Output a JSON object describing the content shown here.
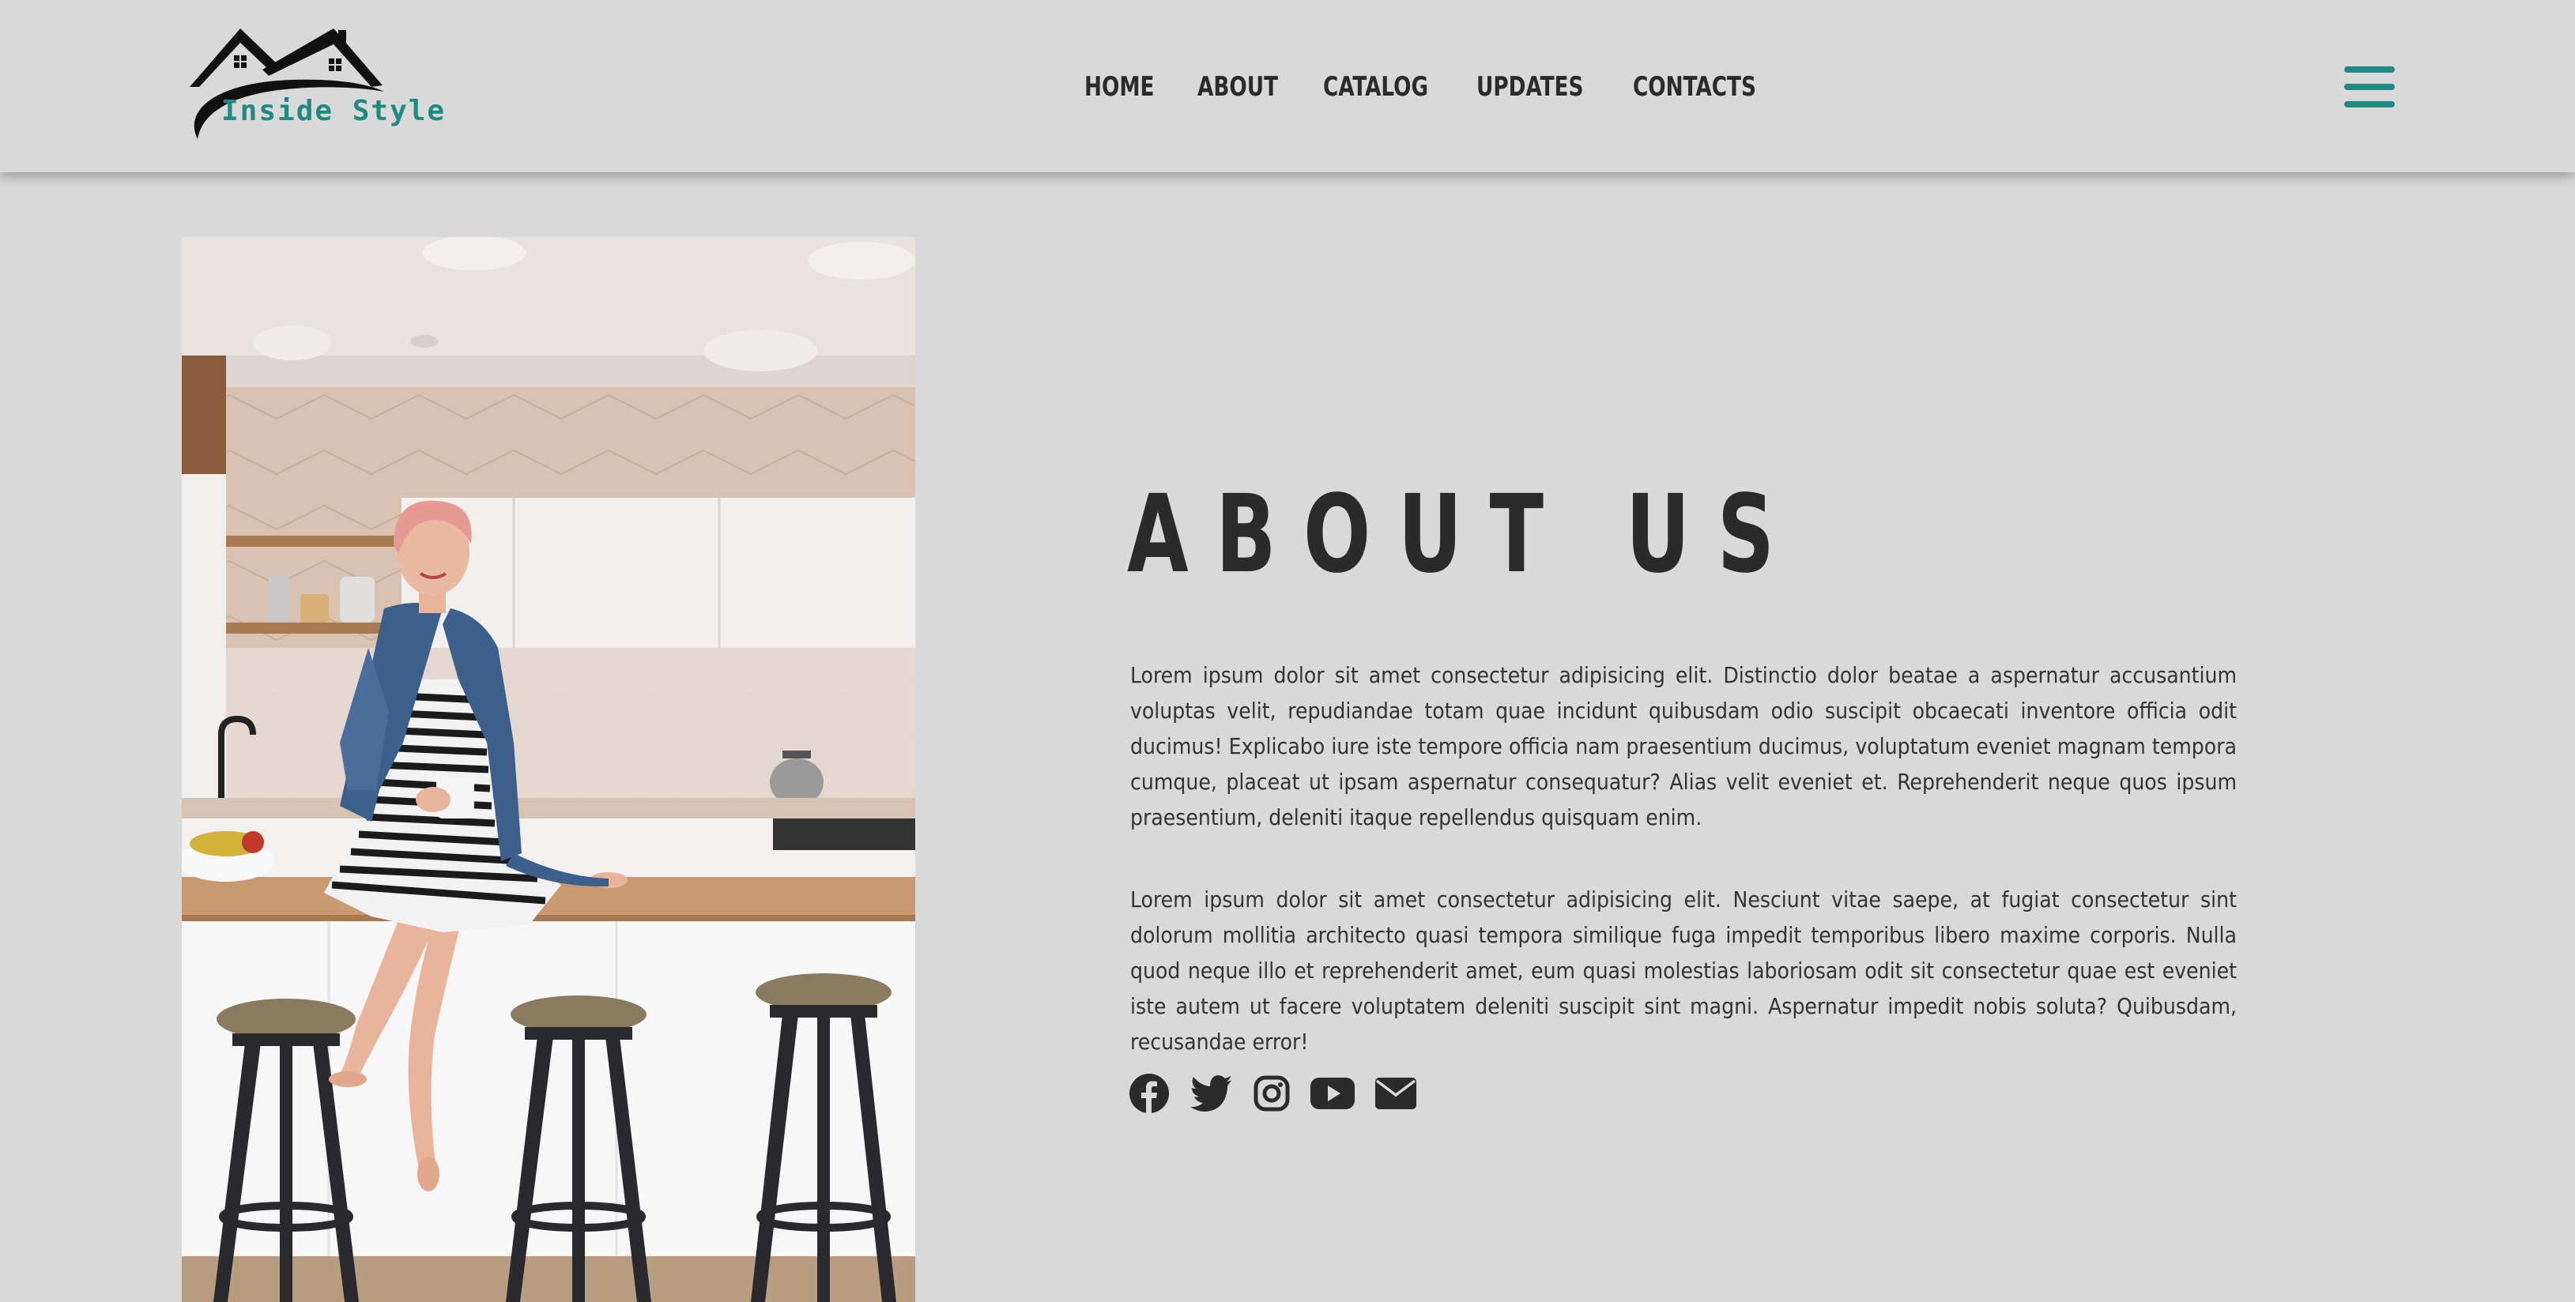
{
  "brand": {
    "name": "Inside Style",
    "accent_color": "#1f8a82"
  },
  "nav": {
    "items": [
      {
        "label": "HOME"
      },
      {
        "label": "ABOUT"
      },
      {
        "label": "CATALOG"
      },
      {
        "label": "UPDATES"
      },
      {
        "label": "CONTACTS"
      }
    ],
    "menu_icon": "hamburger-icon"
  },
  "about": {
    "title": "ABOUT US",
    "paragraph1": "Lorem ipsum dolor sit amet consectetur adipisicing elit. Distinctio dolor beatae a aspernatur accusantium voluptas velit, repudiandae totam quae incidunt quibusdam odio suscipit obcaecati inventore officia odit ducimus! Explicabo iure iste tempore officia nam praesentium ducimus, voluptatum eveniet magnam tempora cumque, placeat ut ipsam aspernatur consequatur? Alias velit eveniet et. Reprehenderit neque quos ipsum praesentium, deleniti itaque repellendus quisquam enim.",
    "paragraph2": "Lorem ipsum dolor sit amet consectetur adipisicing elit. Nesciunt vitae saepe, at fugiat consectetur sint dolorum mollitia architecto quasi tempora similique fuga impedit temporibus libero maxime corporis. Nulla quod neque illo et reprehenderit amet, eum quasi molestias laboriosam odit sit consectetur quae est eveniet iste autem ut facere voluptatem deleniti suscipit sint magni. Aspernatur impedit nobis soluta? Quibusdam, recusandae error!"
  },
  "socials": [
    "facebook-icon",
    "twitter-icon",
    "instagram-icon",
    "youtube-icon",
    "envelope-icon"
  ],
  "colors": {
    "background": "#d9d9d9",
    "text": "#2b2b2b"
  }
}
